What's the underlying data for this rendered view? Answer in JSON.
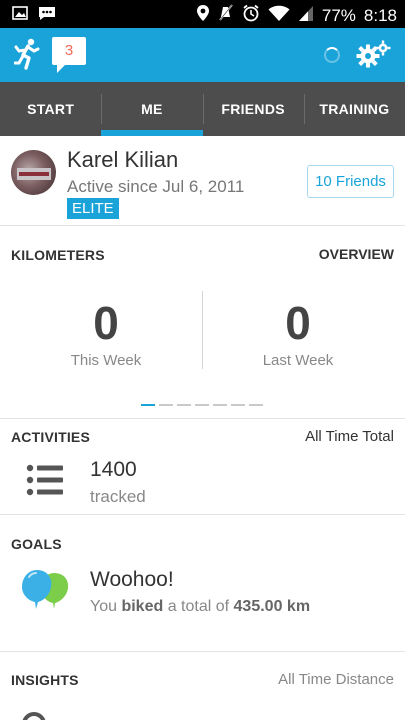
{
  "status_bar": {
    "left_icons": [
      "image-icon",
      "message-icon"
    ],
    "right_icons": [
      "location-icon",
      "mute-icon",
      "alarm-icon",
      "wifi-icon",
      "signal-icon"
    ],
    "battery": "77%",
    "time": "8:18"
  },
  "app_bar": {
    "notification_count": "3",
    "icons": [
      "runner-icon",
      "messages-icon",
      "spinner-icon",
      "settings-icon"
    ]
  },
  "tabs": [
    {
      "label": "START",
      "active": false
    },
    {
      "label": "ME",
      "active": true
    },
    {
      "label": "FRIENDS",
      "active": false
    },
    {
      "label": "TRAINING",
      "active": false
    }
  ],
  "profile": {
    "name": "Karel Kilian",
    "since": "Active since Jul 6, 2011",
    "badge": "ELITE",
    "friends_button": "10 Friends"
  },
  "kilometers": {
    "title": "KILOMETERS",
    "link": "OVERVIEW",
    "this_week_value": "0",
    "this_week_label": "This Week",
    "last_week_value": "0",
    "last_week_label": "Last Week",
    "pager_pages": 7,
    "pager_active": 1
  },
  "activities": {
    "title": "ACTIVITIES",
    "scope": "All Time Total",
    "count": "1400",
    "count_label": "tracked"
  },
  "goals": {
    "title": "GOALS",
    "headline": "Woohoo!",
    "text_prefix": "You",
    "text_activity": "biked",
    "text_middle": "a total of",
    "text_amount": "435.00 km"
  },
  "insights": {
    "title": "INSIGHTS",
    "scope": "All Time Distance"
  },
  "colors": {
    "accent": "#1aa3d9",
    "tab_bar": "#4d4d4d",
    "badge_count": "#f26b5b",
    "balloon_blue": "#3ab0e6",
    "balloon_green": "#7ccd4a"
  }
}
